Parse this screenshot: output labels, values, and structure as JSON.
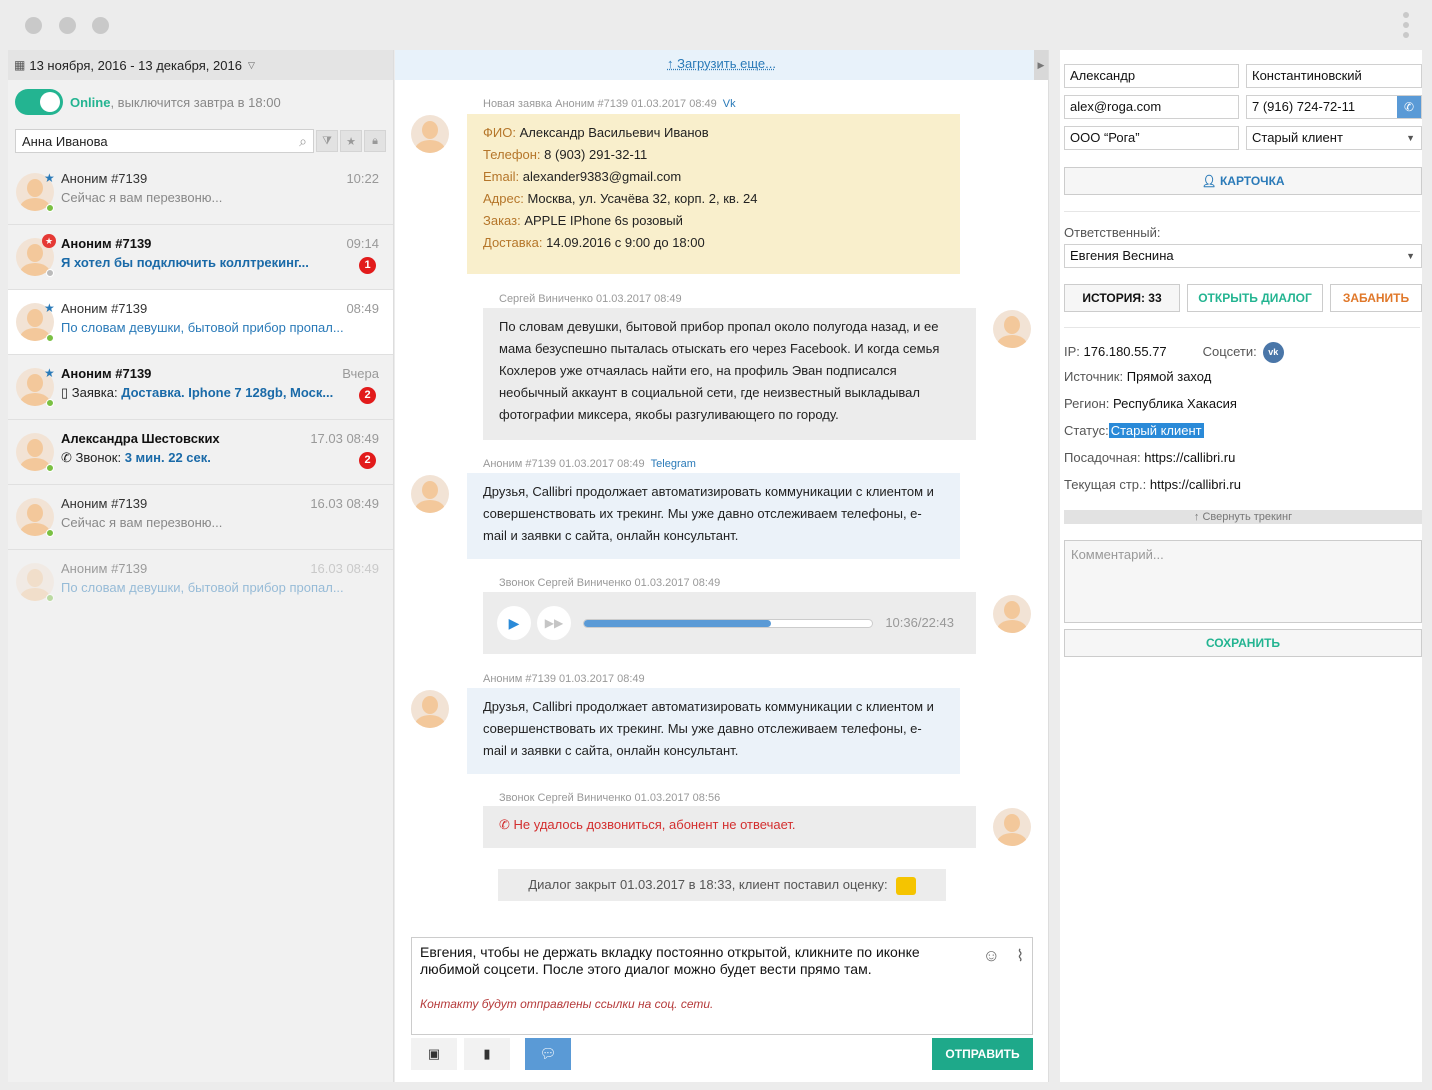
{
  "left": {
    "date_range": "13 ноября, 2016 - 13 декабря, 2016",
    "online_label": "Online",
    "online_rest": ", выключится завтра в 18:00",
    "search_value": "Анна Иванова",
    "contacts": [
      {
        "name": "Аноним #7139",
        "time": "10:22",
        "preview": "Сейчас я вам перезвоню..."
      },
      {
        "name": "Аноним #7139",
        "time": "09:14",
        "preview": "Я хотел бы подключить коллтрекинг...",
        "badge": "1"
      },
      {
        "name": "Аноним #7139",
        "time": "08:49",
        "preview": "По словам девушки, бытовой прибор пропал..."
      },
      {
        "name": "Аноним #7139",
        "time": "Вчера",
        "preview_label": "Заявка:",
        "preview": "Доставка. Iphone 7 128gb, Моск...",
        "badge": "2"
      },
      {
        "name": "Александра Шестовских",
        "time": "17.03  08:49",
        "preview_label": "Звонок:",
        "preview": "3 мин. 22 сек.",
        "badge": "2"
      },
      {
        "name": "Аноним #7139",
        "time": "16.03  08:49",
        "preview": "Сейчас я вам перезвоню..."
      },
      {
        "name": "Аноним #7139",
        "time": "16.03  08:49",
        "preview": "По словам девушки, бытовой прибор пропал..."
      }
    ]
  },
  "chat": {
    "load_more": "↑ Загрузить еще...",
    "m1": {
      "meta": "Новая заявка   Аноним #7139   01.03.2017   08:49",
      "source": "Vk",
      "rows": [
        {
          "k": "ФИО:",
          "v": "Александр Васильевич Иванов"
        },
        {
          "k": "Телефон:",
          "v": "8 (903) 291-32-11"
        },
        {
          "k": "Email:",
          "v": "alexander9383@gmail.com"
        },
        {
          "k": "Адрес:",
          "v": "Москва, ул. Усачёва 32, корп. 2, кв. 24"
        },
        {
          "k": "Заказ:",
          "v": "APPLE IPhone 6s розовый"
        },
        {
          "k": "Доставка:",
          "v": "14.09.2016 с 9:00 до 18:00"
        }
      ]
    },
    "m2": {
      "meta": "Сергей Виниченко   01.03.2017   08:49",
      "text": "По словам девушки, бытовой прибор пропал около полугода назад, и ее мама безуспешно пыталась отыскать его через Facebook. И когда семья Кохлеров уже отчаялась найти его, на профиль Эван подписался необычный аккаунт в социальной сети, где неизвестный выкладывал фотографии миксера, якобы разгуливающего по городу."
    },
    "m3": {
      "meta": "Аноним #7139   01.03.2017   08:49",
      "source": "Telegram",
      "text": "Друзья, Callibri продолжает автоматизировать коммуникации с клиентом и совершенствовать их трекинг. Мы уже давно отслеживаем телефоны, e-mail и заявки с сайта, онлайн консультант."
    },
    "m4": {
      "meta": "Звонок   Сергей Виниченко   01.03.2017   08:49",
      "time": "10:36/22:43",
      "progress": 0.65
    },
    "m5": {
      "meta": "Аноним #7139   01.03.2017   08:49",
      "text": "Друзья, Callibri продолжает автоматизировать коммуникации с клиентом и совершенствовать их трекинг. Мы уже давно отслеживаем телефоны, e-mail и заявки с сайта, онлайн консультант."
    },
    "m6": {
      "meta": "Звонок   Сергей Виниченко   01.03.2017   08:56",
      "text": "Не удалось дозвониться, абонент не отвечает."
    },
    "closed": "Диалог закрыт 01.03.2017 в 18:33, клиент поставил оценку:",
    "composer_text": "Евгения, чтобы не держать вкладку постоянно открытой, кликните по иконке любимой соцсети. После этого диалог можно будет вести прямо там.",
    "composer_hint": "Контакту будут отправлены ссылки на соц. сети.",
    "send_label": "ОТПРАВИТЬ"
  },
  "right": {
    "first_name": "Александр",
    "last_name": "Константиновский",
    "email": "alex@roga.com",
    "phone": "7 (916) 724-72-11",
    "company": "ООО “Рога”",
    "client_type": "Старый клиент",
    "card_label": "КАРТОЧКА",
    "responsible_label": "Ответственный:",
    "responsible": "Евгения Веснина",
    "history_label": "ИСТОРИЯ: 33",
    "open_dialog_label": "ОТКРЫТЬ ДИАЛОГ",
    "ban_label": "ЗАБАНИТЬ",
    "ip_label": "IP:",
    "ip": "176.180.55.77",
    "social_label": "Соцсети:",
    "source_label": "Источник:",
    "source": "Прямой заход",
    "region_label": "Регион:",
    "region": "Республика Хакасия",
    "status_label": "Статус:",
    "status": "Старый клиент",
    "landing_label": "Посадочная:",
    "landing": "https://callibri.ru",
    "current_label": "Текущая стр.:",
    "current": "https://callibri.ru",
    "collapse_tracking": "↑ Свернуть трекинг",
    "comment_placeholder": "Комментарий...",
    "save_label": "СОХРАНИТЬ"
  },
  "colors": {
    "accent_green": "#23b491",
    "accent_blue": "#2a7ab8",
    "badge_red": "#e21b1b",
    "ban_orange": "#e0782a"
  }
}
